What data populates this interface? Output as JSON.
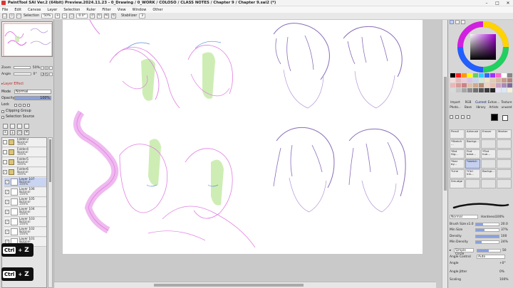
{
  "window": {
    "title": "PaintTool SAI Ver.2 (64bit) Preview.2024.11.23 - 0_Drawing / 0_WORK / COLOSO / CLASS NOTES / Chapter 9 / Chapter 9.sai2 (*)",
    "minimize": "–",
    "maximize": "□",
    "close": "✕"
  },
  "menu": [
    "File",
    "Edit",
    "Canvas",
    "Layer",
    "Selection",
    "Ruler",
    "Filter",
    "View",
    "Window",
    "Other"
  ],
  "toolbar": {
    "selection_label": "Selection",
    "zoom": "50%",
    "angle": "0.0°",
    "stabilizer_label": "Stabilizer",
    "stabilizer_value": "3"
  },
  "navigator": {
    "zoom_label": "Zoom",
    "zoom_value": "50%",
    "angle_label": "Angle",
    "angle_value": "0°"
  },
  "layer_props": {
    "section_label": "Layer Effect",
    "mode_label": "Mode",
    "mode_value": "Normal",
    "opacity_label": "Opacity",
    "opacity_value": "100%",
    "lock_label": "Lock",
    "clipping_label": "Clipping Group",
    "selection_source_label": "Selection Source"
  },
  "layers": [
    {
      "name": "Folder3",
      "mode": "Normal",
      "opacity": "100%",
      "type": "folder"
    },
    {
      "name": "Folder4",
      "mode": "Normal",
      "opacity": "100%",
      "type": "folder"
    },
    {
      "name": "Folder5",
      "mode": "Normal",
      "opacity": "100%",
      "type": "folder"
    },
    {
      "name": "Folder6",
      "mode": "Normal",
      "opacity": "100%",
      "type": "folder"
    },
    {
      "name": "Layer 107",
      "mode": "Normal",
      "opacity": "100%",
      "type": "layer"
    },
    {
      "name": "Layer 106",
      "mode": "Normal",
      "opacity": "100%",
      "type": "layer"
    },
    {
      "name": "Layer 105",
      "mode": "Normal",
      "opacity": "100%",
      "type": "layer"
    },
    {
      "name": "Layer 104",
      "mode": "Normal",
      "opacity": "100%",
      "type": "layer"
    },
    {
      "name": "Layer 103",
      "mode": "Normal",
      "opacity": "100%",
      "type": "layer"
    },
    {
      "name": "Layer 102",
      "mode": "Normal",
      "opacity": "100%",
      "type": "layer"
    },
    {
      "name": "Layer 101",
      "mode": "Normal",
      "opacity": "100%",
      "type": "layer"
    }
  ],
  "shortcuts": [
    {
      "key": "Ctrl",
      "plus": "+",
      "letter": "Z"
    },
    {
      "key": "Ctrl",
      "plus": "+",
      "letter": "Z"
    }
  ],
  "palette_tabs": [
    "Import",
    "RGB",
    "Current",
    "Exhan...",
    "Texture"
  ],
  "palette_tabs2": [
    "Photo...",
    "Base",
    "library",
    "Artists",
    "unused"
  ],
  "tools": [
    {
      "label": "Pencil",
      "sel": false
    },
    {
      "label": "Airbrush",
      "sel": false
    },
    {
      "label": "Eraser",
      "sel": false
    },
    {
      "label": "Marker",
      "sel": false
    },
    {
      "label": "*Sketch ...",
      "sel": false
    },
    {
      "label": "Backgr...",
      "sel": false
    },
    {
      "label": "",
      "sel": false
    },
    {
      "label": "",
      "sel": false
    },
    {
      "label": "*flat Sig...",
      "sel": false
    },
    {
      "label": "Flat base...",
      "sel": false
    },
    {
      "label": "*Flat hue...",
      "sel": false
    },
    {
      "label": "",
      "sel": false
    },
    {
      "label": "*Ikar by...",
      "sel": false
    },
    {
      "label": "*sketch",
      "sel": true
    },
    {
      "label": "",
      "sel": false
    },
    {
      "label": "",
      "sel": false
    },
    {
      "label": "*Line",
      "sel": false
    },
    {
      "label": "*Ctrl Ink...",
      "sel": false
    },
    {
      "label": "Backgr...",
      "sel": false
    },
    {
      "label": "",
      "sel": false
    },
    {
      "label": "Smudge",
      "sel": false
    },
    {
      "label": "",
      "sel": false
    },
    {
      "label": "",
      "sel": false
    },
    {
      "label": "",
      "sel": false
    }
  ],
  "brush": {
    "mode_value": "Normal",
    "hardness_label": "Hardness",
    "hardness_value": "100%",
    "size_label": "Brush Size",
    "size_mult": "x1.0",
    "size_value": "20.0",
    "min_size_label": "Min Size",
    "min_size_value": "37%",
    "density_label": "Density",
    "density_value": "100",
    "min_density_label": "Min Density",
    "min_density_value": "24%",
    "shape_label": "Simple Circle",
    "shape_value": "50",
    "blend_label": "Angle Control",
    "blend_value": "Auto",
    "angle_label": "Angle",
    "angle_value": "+0°",
    "jitter_label": "Angle Jitter",
    "jitter_value": "0%",
    "scaling_label": "Scaling",
    "scaling_value": "100%"
  },
  "colors": {
    "accent": "#7e8fc7",
    "sketch_pink": "#e27fe2",
    "sketch_violet": "#b593d6",
    "wash_green": "#c2e8a2",
    "brush_fg": "#000000",
    "brush_bg": "#ffffff"
  }
}
